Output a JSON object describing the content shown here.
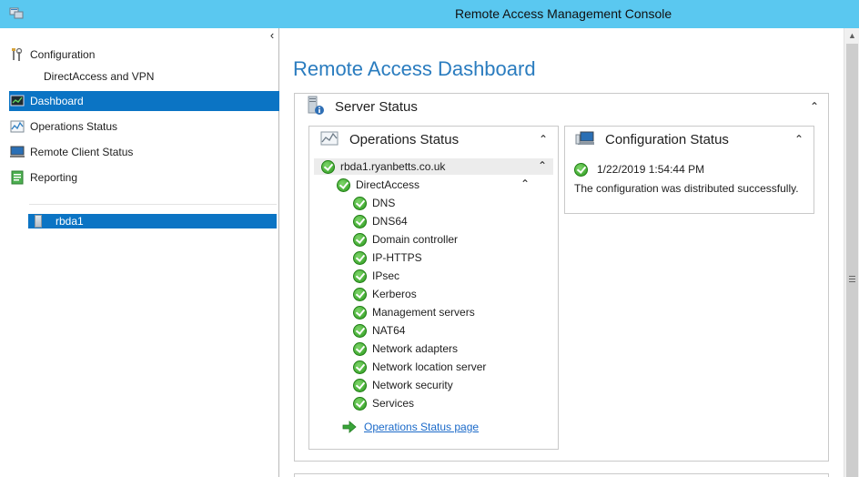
{
  "window": {
    "title": "Remote Access Management Console"
  },
  "nav": {
    "collapse_glyph": "‹",
    "configuration_label": "Configuration",
    "directaccess_vpn_label": "DirectAccess and VPN",
    "dashboard_label": "Dashboard",
    "operations_status_label": "Operations Status",
    "remote_client_status_label": "Remote Client Status",
    "reporting_label": "Reporting",
    "server_label": "rbda1"
  },
  "main": {
    "title": "Remote Access Dashboard",
    "server_status": {
      "title": "Server Status",
      "chevron": "⌃"
    },
    "operations_status": {
      "title": "Operations Status",
      "chevron": "⌃",
      "server_name": "rbda1.ryanbetts.co.uk",
      "group_name": "DirectAccess",
      "components": [
        "DNS",
        "DNS64",
        "Domain controller",
        "IP-HTTPS",
        "IPsec",
        "Kerberos",
        "Management servers",
        "NAT64",
        "Network adapters",
        "Network location server",
        "Network security",
        "Services"
      ],
      "link_label": "Operations Status page"
    },
    "configuration_status": {
      "title": "Configuration Status",
      "chevron": "⌃",
      "timestamp": "1/22/2019 1:54:44 PM",
      "message": "The configuration was distributed successfully."
    }
  },
  "colors": {
    "titlebar": "#5ac8f0",
    "selection": "#0b74c4",
    "heading": "#2a7cbf",
    "link": "#1b6ac9",
    "ok_green": "#2c9a1e"
  },
  "icons": {
    "status_ok": "check-circle-icon",
    "link_arrow": "green-arrow-icon"
  }
}
